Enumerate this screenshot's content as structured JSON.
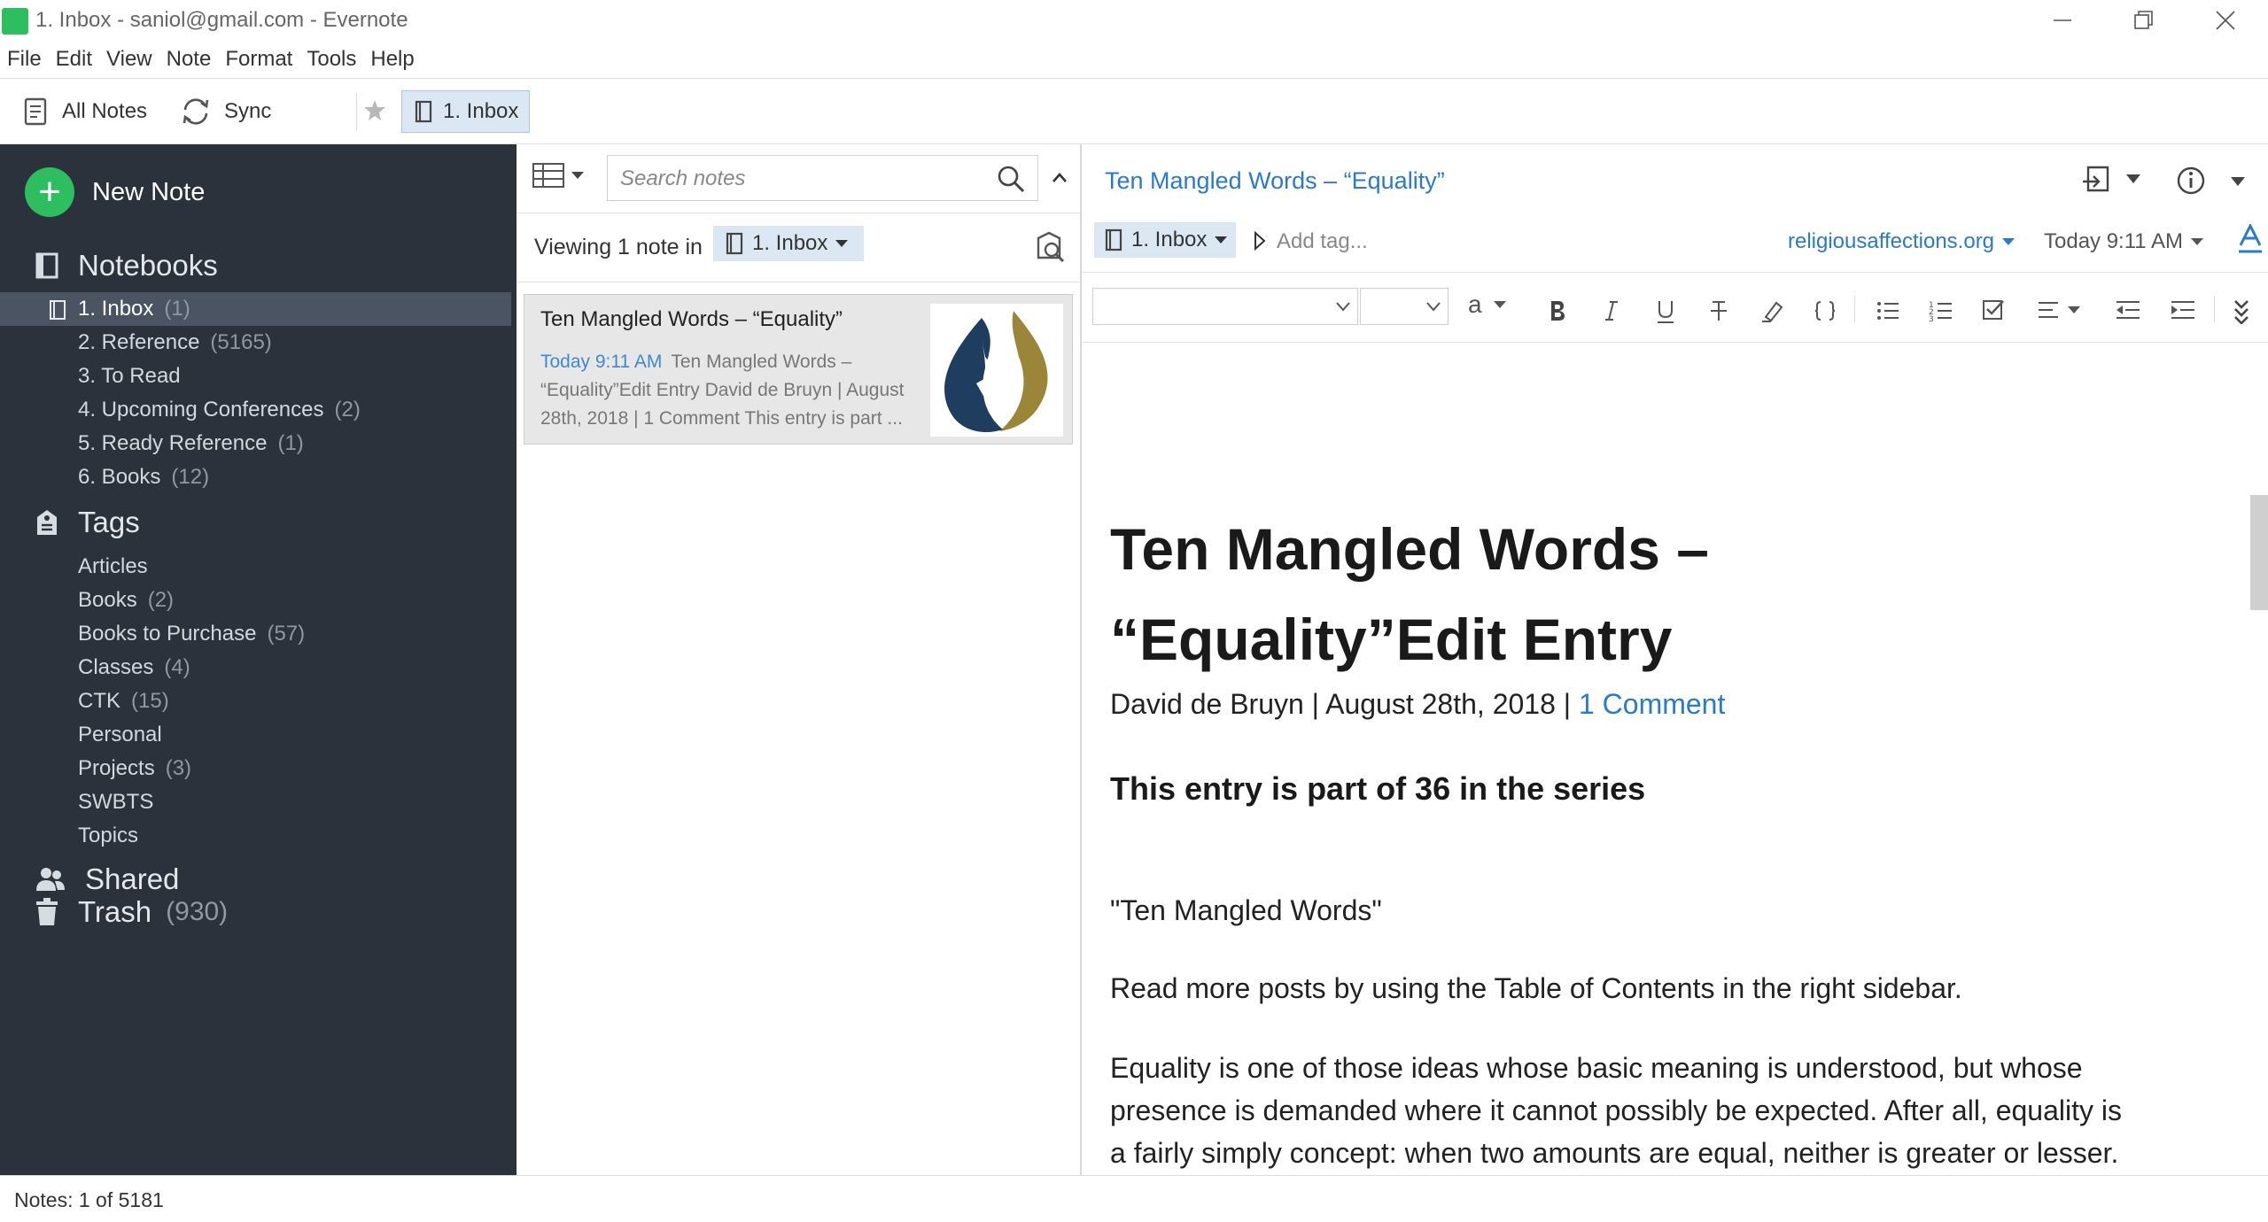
{
  "window": {
    "title": "1. Inbox - saniol@gmail.com - Evernote"
  },
  "menu": [
    "File",
    "Edit",
    "View",
    "Note",
    "Format",
    "Tools",
    "Help"
  ],
  "toolbar": {
    "all_notes": "All Notes",
    "sync": "Sync",
    "shortcut": "1. Inbox"
  },
  "sidebar": {
    "new_note": "New Note",
    "notebooks_label": "Notebooks",
    "notebooks": [
      {
        "name": "1. Inbox",
        "count": "(1)"
      },
      {
        "name": "2. Reference",
        "count": "(5165)"
      },
      {
        "name": "3. To Read",
        "count": ""
      },
      {
        "name": "4. Upcoming Conferences",
        "count": "(2)"
      },
      {
        "name": "5. Ready Reference",
        "count": "(1)"
      },
      {
        "name": "6. Books",
        "count": "(12)"
      }
    ],
    "tags_label": "Tags",
    "tags": [
      {
        "name": "Articles",
        "count": ""
      },
      {
        "name": "Books",
        "count": "(2)"
      },
      {
        "name": "Books to Purchase",
        "count": "(57)"
      },
      {
        "name": "Classes",
        "count": "(4)"
      },
      {
        "name": "CTK",
        "count": "(15)"
      },
      {
        "name": "Personal",
        "count": ""
      },
      {
        "name": "Projects",
        "count": "(3)"
      },
      {
        "name": "SWBTS",
        "count": ""
      },
      {
        "name": "Topics",
        "count": ""
      }
    ],
    "shared_label": "Shared",
    "trash_label": "Trash",
    "trash_count": "(930)"
  },
  "note_list": {
    "search_placeholder": "Search notes",
    "viewing_label": "Viewing 1 note in",
    "notebook": "1. Inbox",
    "notes": [
      {
        "title": "Ten Mangled Words – “Equality”",
        "date": "Today 9:11 AM",
        "snippet": "Ten Mangled Words – “Equality”Edit Entry David de Bruyn | August 28th, 2018 | 1 Comment This entry is part ..."
      }
    ]
  },
  "editor": {
    "title": "Ten Mangled Words – “Equality”",
    "notebook": "1. Inbox",
    "add_tag": "Add tag...",
    "source": "religiousaffections.org",
    "date": "Today 9:11 AM",
    "font_size_glyph": "a",
    "heading": "Ten Mangled Words – “Equality”Edit Entry",
    "byline": "David de Bruyn | August 28th, 2018 | ",
    "byline_link": "1 Comment",
    "series": "This entry is part of 36 in the series",
    "paragraphs": [
      "\"Ten Mangled Words\"",
      "Read more posts by using the Table of Contents in the right sidebar.",
      "Equality is one of those ideas whose basic meaning is understood, but whose presence is demanded where it cannot possibly be expected. After all, equality is a fairly simply concept: when two amounts are equal, neither is greater or lesser."
    ]
  },
  "status": {
    "text": "Notes: 1 of 5181"
  },
  "colors": {
    "sidebar_bg": "#2b323c",
    "accent_green": "#2dbe60",
    "link_blue": "#2a7ac8",
    "selection_blue": "#dbe8f4"
  }
}
